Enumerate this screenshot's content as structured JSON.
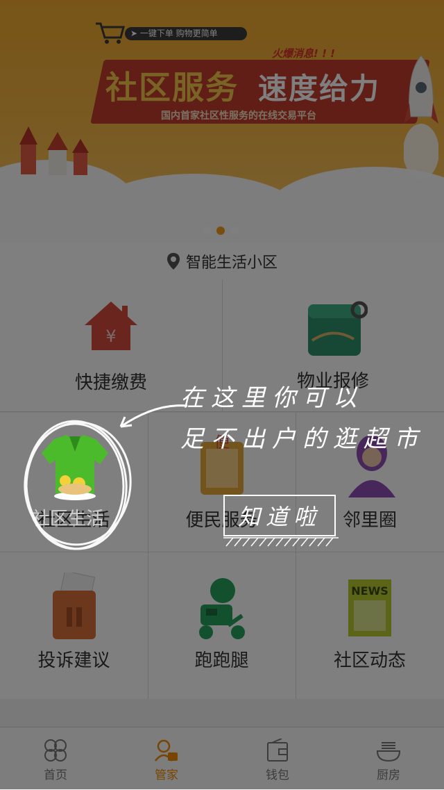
{
  "banner": {
    "promo_pill": "➤ 一键下单   购物更简单",
    "hot_tag": "火爆消息! ! !",
    "headline_main": "社区服务",
    "headline_accent": "速度给力",
    "subline": "国内首家社区性服务的在线交易平台",
    "carousel_dots": 3,
    "active_dot": 1
  },
  "location": {
    "icon": "location-pin-icon",
    "label": "智能生活小区"
  },
  "services": [
    {
      "label": "快捷缴费",
      "icon": "house-payment-icon",
      "color": "#d44b3c"
    },
    {
      "label": "物业报修",
      "icon": "repair-card-icon",
      "color": "#2f8f6a"
    },
    {
      "label": "社区生活",
      "icon": "community-life-icon",
      "color": "#4cbb2b"
    },
    {
      "label": "便民服务",
      "icon": "convenience-service-icon",
      "color": "#e8a93b"
    },
    {
      "label": "邻里圈",
      "icon": "neighbor-circle-icon",
      "color": "#8e4fb3"
    },
    {
      "label": "投诉建议",
      "icon": "complaint-box-icon",
      "color": "#d8703a"
    },
    {
      "label": "跑跑腿",
      "icon": "scooter-courier-icon",
      "color": "#27a05a"
    },
    {
      "label": "社区动态",
      "icon": "news-icon",
      "color": "#b7c92f"
    }
  ],
  "tabbar": {
    "items": [
      {
        "label": "首页",
        "icon": "home-clover-icon",
        "active": false
      },
      {
        "label": "管家",
        "icon": "butler-icon",
        "active": true
      },
      {
        "label": "钱包",
        "icon": "wallet-icon",
        "active": false
      },
      {
        "label": "厨房",
        "icon": "kitchen-bowl-icon",
        "active": false
      }
    ]
  },
  "guide": {
    "tip_line1": "在这里你可以",
    "tip_line2": "足不出户的逛超市",
    "button_label": "知道啦"
  },
  "colors": {
    "accent": "#f08a00",
    "banner": "#f0a92f",
    "overlay": "rgba(0,0,0,0.5)"
  }
}
